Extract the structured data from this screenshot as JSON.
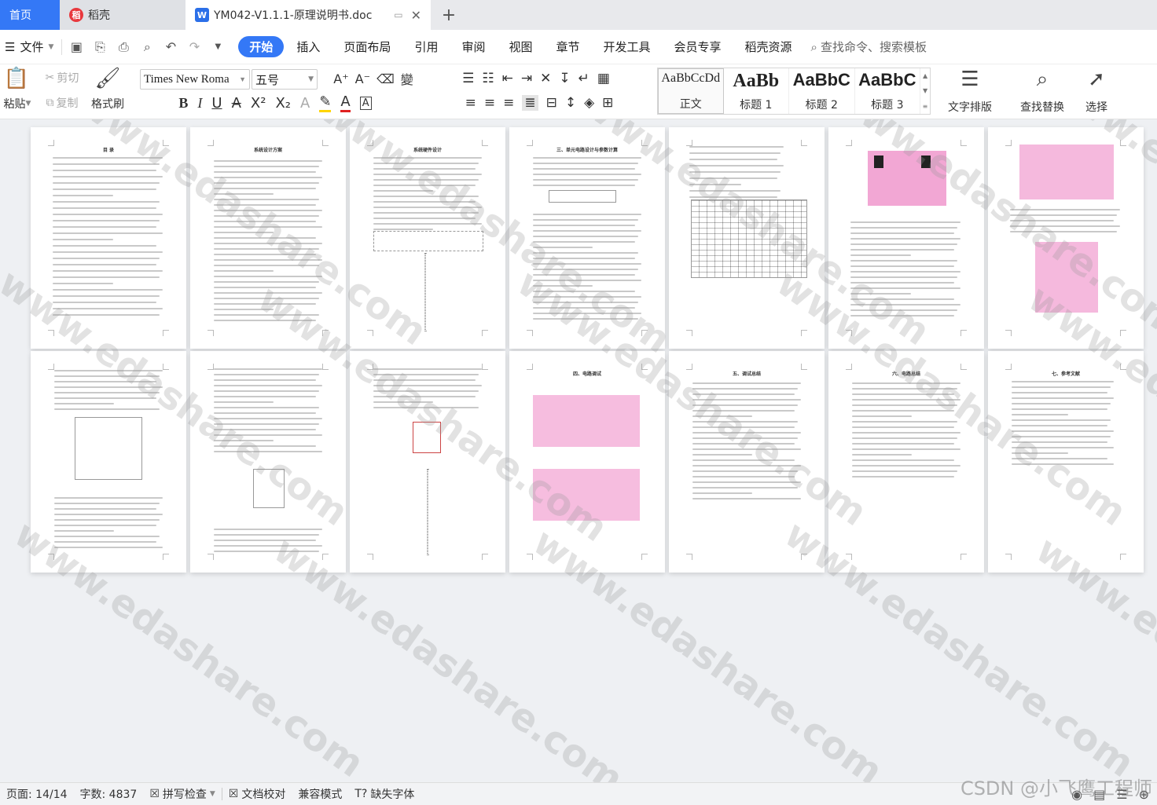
{
  "tabs": {
    "home": "首页",
    "app": "稻壳",
    "doc": "YM042-V1.1.1-原理说明书.doc",
    "add": "+"
  },
  "menubar": {
    "file": "文件",
    "items": [
      "开始",
      "插入",
      "页面布局",
      "引用",
      "审阅",
      "视图",
      "章节",
      "开发工具",
      "会员专享",
      "稻壳资源"
    ],
    "search": "查找命令、搜索模板"
  },
  "ribbon": {
    "paste": "粘贴",
    "cut": "剪切",
    "copy": "复制",
    "format_painter": "格式刷",
    "font_name": "Times New Roma",
    "font_size": "五号",
    "styles": [
      {
        "sample": "AaBbCcDd",
        "name": "正文"
      },
      {
        "sample": "AaBb",
        "name": "标题 1"
      },
      {
        "sample": "AaBbC",
        "name": "标题 2"
      },
      {
        "sample": "AaBbC",
        "name": "标题 3"
      }
    ],
    "text_layout": "文字排版",
    "find_replace": "查找替换",
    "select": "选择"
  },
  "pages": {
    "toc_title": "目  录",
    "p2_title": "系统设计方案",
    "p3_title": "系统硬件设计",
    "p4_title": "三、单元电路设计与参数计算",
    "p11_title": "四、电路调试",
    "p12_title": "五、调试总结",
    "p13_title": "六、电路总结",
    "p14_title": "七、参考文献"
  },
  "watermark": "www.edashare.com",
  "statusbar": {
    "page": "页面: 14/14",
    "words": "字数: 4837",
    "spell": "拼写检查",
    "proof": "文档校对",
    "compat": "兼容模式",
    "missing_font": "缺失字体"
  },
  "csdn": "CSDN @小飞鹰工程师"
}
